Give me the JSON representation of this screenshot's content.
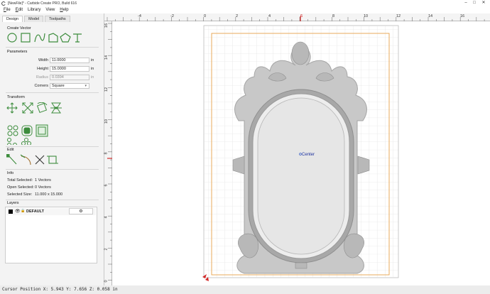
{
  "window": {
    "title": "[NewFile]* - Carbide Create PRO, Build 616",
    "controls": [
      "–",
      "□",
      "✕"
    ]
  },
  "menu": [
    {
      "accel": "F",
      "rest": "ile"
    },
    {
      "accel": "E",
      "rest": "dit"
    },
    {
      "accel": "",
      "rest": "Library"
    },
    {
      "accel": "",
      "rest": "View"
    },
    {
      "accel": "H",
      "rest": "elp"
    }
  ],
  "tabs": [
    "Design",
    "Model",
    "Toolpaths"
  ],
  "create_vector": {
    "title": "Create Vector",
    "tools": [
      "circle-tool",
      "rectangle-tool",
      "curve-tool",
      "polyline-tool",
      "polygon-tool",
      "text-tool"
    ]
  },
  "parameters": {
    "title": "Parameters",
    "width": {
      "label": "Width",
      "value": "11.0000",
      "unit": "in"
    },
    "height": {
      "label": "Height",
      "value": "15.0000",
      "unit": "in"
    },
    "radius": {
      "label": "Radius",
      "value": "0.0394",
      "unit": "in"
    },
    "corners": {
      "label": "Corners",
      "value": "Square"
    }
  },
  "transform": {
    "title": "Transform"
  },
  "edit": {
    "title": "Edit"
  },
  "info": {
    "title": "Info",
    "total_selected": {
      "label": "Total Selected:",
      "value": "1 Vectors"
    },
    "open_selected": {
      "label": "Open Selected:",
      "value": "0 Vectors"
    },
    "selected_size": {
      "label": "Selected Size:",
      "value": "11.000 x 15.000"
    }
  },
  "layers": {
    "title": "Layers",
    "items": [
      {
        "name": "DEFAULT",
        "color": "#000000"
      }
    ]
  },
  "ruler": {
    "top": [
      "-4",
      "-2",
      "0",
      "2",
      "4",
      "6",
      "8",
      "10",
      "12",
      "14",
      "16"
    ],
    "left": [
      "16",
      "14",
      "12",
      "10",
      "8",
      "6",
      "4",
      "2",
      "0"
    ]
  },
  "canvas": {
    "center_label": "Center",
    "accent": "#e8a24a"
  },
  "status": {
    "cursor_text": "Cursor Position X: 5.943 Y: 7.656 Z: 0.058 in"
  }
}
